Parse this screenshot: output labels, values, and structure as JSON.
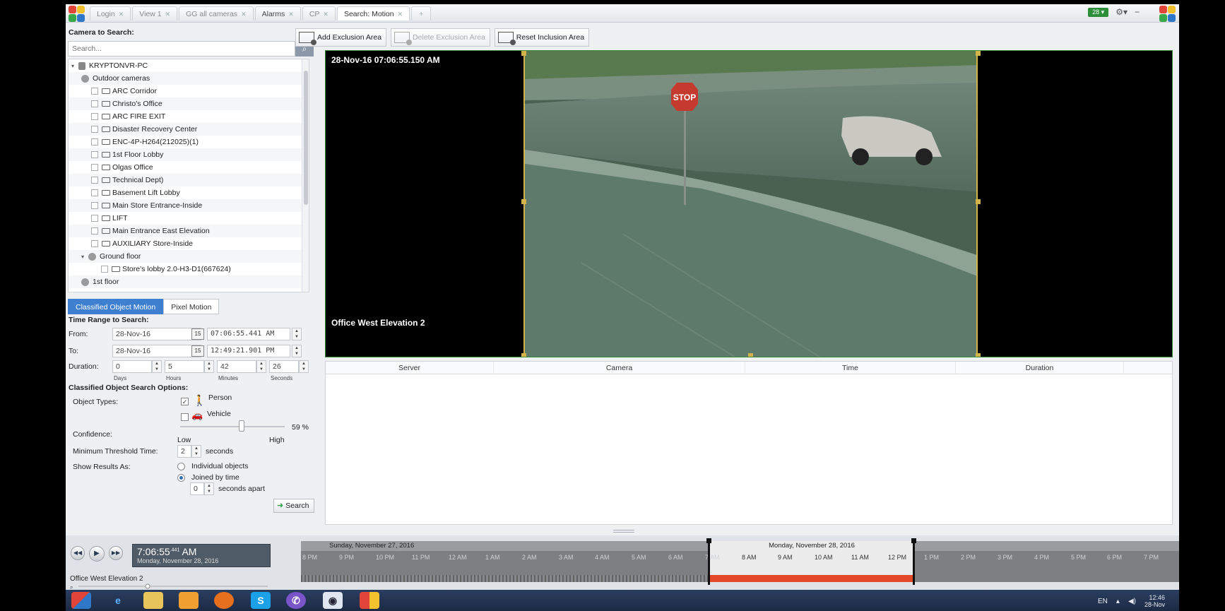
{
  "tabs": [
    {
      "label": "Login",
      "active": false
    },
    {
      "label": "View 1",
      "active": false
    },
    {
      "label": "GG all cameras",
      "active": false
    },
    {
      "label": "Alarms",
      "active": false
    },
    {
      "label": "CP",
      "active": false
    },
    {
      "label": "Search: Motion",
      "active": true
    }
  ],
  "top_right": {
    "badge": "28 ▾",
    "gear": "⚙▾",
    "minimize": "−"
  },
  "camera_search": {
    "title": "Camera to Search:",
    "placeholder": "Search...",
    "tree": [
      {
        "type": "server",
        "label": "KRYPTONVR-PC",
        "indent": 0,
        "expander": "▾"
      },
      {
        "type": "group",
        "label": "Outdoor cameras",
        "indent": 1
      },
      {
        "type": "camera",
        "label": "ARC Corridor",
        "indent": 2
      },
      {
        "type": "camera",
        "label": "Christo's Office",
        "indent": 2
      },
      {
        "type": "camera",
        "label": "ARC FIRE EXIT",
        "indent": 2
      },
      {
        "type": "camera",
        "label": "Disaster Recovery Center",
        "indent": 2
      },
      {
        "type": "camera",
        "label": "ENC-4P-H264(212025)(1)",
        "indent": 2
      },
      {
        "type": "camera",
        "label": "1st Floor Lobby",
        "indent": 2
      },
      {
        "type": "camera",
        "label": "Olgas Office",
        "indent": 2
      },
      {
        "type": "camera",
        "label": "Technical Dept)",
        "indent": 2
      },
      {
        "type": "camera",
        "label": "Basement Lift Lobby",
        "indent": 2
      },
      {
        "type": "camera",
        "label": "Main Store Entrance-Inside",
        "indent": 2
      },
      {
        "type": "camera",
        "label": "LIFT",
        "indent": 2
      },
      {
        "type": "camera",
        "label": "Main Entrance East Elevation",
        "indent": 2
      },
      {
        "type": "camera",
        "label": "AUXILIARY Store-Inside",
        "indent": 2
      },
      {
        "type": "group",
        "label": "Ground floor",
        "indent": 1,
        "expander": "▾"
      },
      {
        "type": "camera",
        "label": "Store's lobby 2.0-H3-D1(667624)",
        "indent": 3
      },
      {
        "type": "group",
        "label": "1st floor",
        "indent": 1
      }
    ]
  },
  "mode": {
    "classified": "Classified Object Motion",
    "pixel": "Pixel Motion"
  },
  "time_range": {
    "title": "Time Range to Search:",
    "from_label": "From:",
    "from_date": "28-Nov-16",
    "from_time": "07:06:55.441 AM",
    "to_label": "To:",
    "to_date": "28-Nov-16",
    "to_time": "12:49:21.901 PM",
    "cal_icon": "15",
    "duration_label": "Duration:",
    "duration": {
      "days": "0",
      "hours": "5",
      "minutes": "42",
      "seconds": "26"
    },
    "units": {
      "days": "Days",
      "hours": "Hours",
      "minutes": "Minutes",
      "seconds": "Seconds"
    }
  },
  "options": {
    "title": "Classified Object Search Options:",
    "object_types_label": "Object Types:",
    "person": "Person",
    "person_checked": true,
    "vehicle": "Vehicle",
    "vehicle_checked": false,
    "confidence_label": "Confidence:",
    "confidence_value": "59 %",
    "confidence_fraction": 0.59,
    "low": "Low",
    "high": "High",
    "min_threshold_label": "Minimum Threshold Time:",
    "min_threshold_value": "2",
    "seconds": "seconds",
    "show_results_label": "Show Results As:",
    "individual": "Individual objects",
    "joined": "Joined by time",
    "apart_value": "0",
    "apart_label": "seconds apart",
    "search_button": "Search"
  },
  "toolbar": {
    "add_exclusion": "Add Exclusion Area",
    "delete_exclusion": "Delete Exclusion Area",
    "reset_inclusion": "Reset Inclusion Area"
  },
  "video": {
    "timestamp": "28-Nov-16 07:06:55.150 AM",
    "camera_name": "Office West Elevation 2",
    "stop_sign": "STOP"
  },
  "results": {
    "columns": [
      "Server",
      "Camera",
      "Time",
      "Duration"
    ]
  },
  "timeline": {
    "clock_time": "7:06:55",
    "clock_ms": ".441",
    "clock_ampm": "AM",
    "clock_date": "Monday, November 28, 2016",
    "camera": "Office West Elevation 2",
    "day1": "Sunday, November 27, 2016",
    "day2": "Monday, November 28, 2016",
    "hours": [
      "8 PM",
      "9 PM",
      "10 PM",
      "11 PM",
      "12 AM",
      "1 AM",
      "2 AM",
      "3 AM",
      "4 AM",
      "5 AM",
      "6 AM",
      "7 AM",
      "8 AM",
      "9 AM",
      "10 AM",
      "11 AM",
      "12 PM",
      "1 PM",
      "2 PM",
      "3 PM",
      "4 PM",
      "5 PM",
      "6 PM",
      "7 PM"
    ]
  },
  "taskbar": {
    "lang": "EN",
    "time": "12:46",
    "date": "28-Nov"
  },
  "colors": {
    "accent": "#3f7fd0",
    "recording": "#e24a2a",
    "inclusion_border": "#d2b24a"
  }
}
